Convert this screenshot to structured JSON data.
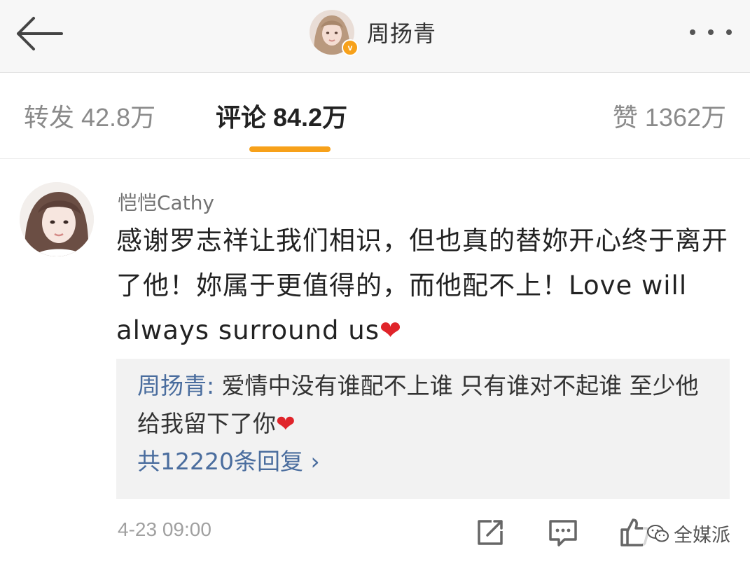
{
  "nav": {
    "back_icon": "back-arrow-icon",
    "title": "周扬青",
    "verified_badge": "v",
    "more_icon": "more-dots-icon"
  },
  "tabs": [
    {
      "label": "转发",
      "count": "42.8万",
      "active": false
    },
    {
      "label": "评论",
      "count": "84.2万",
      "active": true
    },
    {
      "label": "赞",
      "count": "1362万",
      "active": false
    }
  ],
  "comment": {
    "username": "恺恺Cathy",
    "text": "感谢罗志祥让我们相识，但也真的替妳开心终于离开了他！妳属于更值得的，而他配不上！Love will always surround us",
    "emoji": "❤",
    "reply": {
      "author": "周扬青:",
      "text": "爱情中没有谁配不上谁 只有谁对不起谁 至少他给我留下了你",
      "emoji": "❤",
      "count_label": "共12220条回复 ›"
    },
    "time": "4-23 09:00",
    "actions": {
      "share_icon": "share-icon",
      "reply_icon": "comment-icon",
      "like_icon": "thumbs-up-icon"
    }
  },
  "watermark": "全媒派",
  "colors": {
    "accent": "#f7a11a",
    "link": "#4a6d9e",
    "heart": "#e0242a",
    "reply_bg": "#f2f2f2"
  }
}
